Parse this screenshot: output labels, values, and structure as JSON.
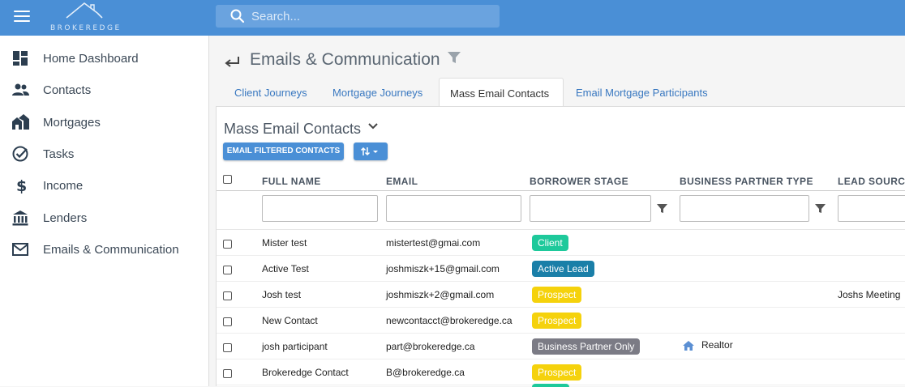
{
  "app": {
    "logo_text": "BROKEREDGE",
    "search_placeholder": "Search..."
  },
  "colors": {
    "topbar": "#4a8fd6",
    "client": "#1ec99b",
    "active_lead": "#1a7fa8",
    "prospect": "#f5d20c",
    "business_partner": "#7b7b85"
  },
  "sidebar": {
    "items": [
      {
        "label": "Home Dashboard",
        "icon": "dashboard-icon"
      },
      {
        "label": "Contacts",
        "icon": "people-icon"
      },
      {
        "label": "Mortgages",
        "icon": "houses-icon"
      },
      {
        "label": "Tasks",
        "icon": "check-circle-icon"
      },
      {
        "label": "Income",
        "icon": "dollar-icon"
      },
      {
        "label": "Lenders",
        "icon": "bank-icon"
      },
      {
        "label": "Emails & Communication",
        "icon": "mail-icon"
      }
    ]
  },
  "page": {
    "title": "Emails & Communication"
  },
  "tabs": [
    {
      "label": "Client Journeys"
    },
    {
      "label": "Mortgage Journeys"
    },
    {
      "label": "Mass Email Contacts"
    },
    {
      "label": "Email Mortgage Participants"
    }
  ],
  "panel": {
    "title": "Mass Email Contacts",
    "email_button": "EMAIL FILTERED CONTACTS"
  },
  "table": {
    "columns": [
      "FULL NAME",
      "EMAIL",
      "BORROWER STAGE",
      "BUSINESS PARTNER TYPE",
      "LEAD SOURCE"
    ],
    "rows": [
      {
        "name": "Mister test",
        "email": "mistertest@gmai.com",
        "stage": "Client",
        "partner_type": "",
        "lead_source": ""
      },
      {
        "name": "Active Test",
        "email": "joshmiszk+15@gmail.com",
        "stage": "Active Lead",
        "partner_type": "",
        "lead_source": ""
      },
      {
        "name": "Josh test",
        "email": "joshmiszk+2@gmail.com",
        "stage": "Prospect",
        "partner_type": "",
        "lead_source": "Joshs Meeting"
      },
      {
        "name": "New Contact",
        "email": "newcontacct@brokeredge.ca",
        "stage": "Prospect",
        "partner_type": "",
        "lead_source": ""
      },
      {
        "name": "josh participant",
        "email": "part@brokeredge.ca",
        "stage": "Business Partner Only",
        "partner_type": "Realtor",
        "lead_source": ""
      },
      {
        "name": "Brokeredge Contact",
        "email": "B@brokeredge.ca",
        "stage": "Prospect",
        "partner_type": "",
        "lead_source": ""
      }
    ]
  }
}
